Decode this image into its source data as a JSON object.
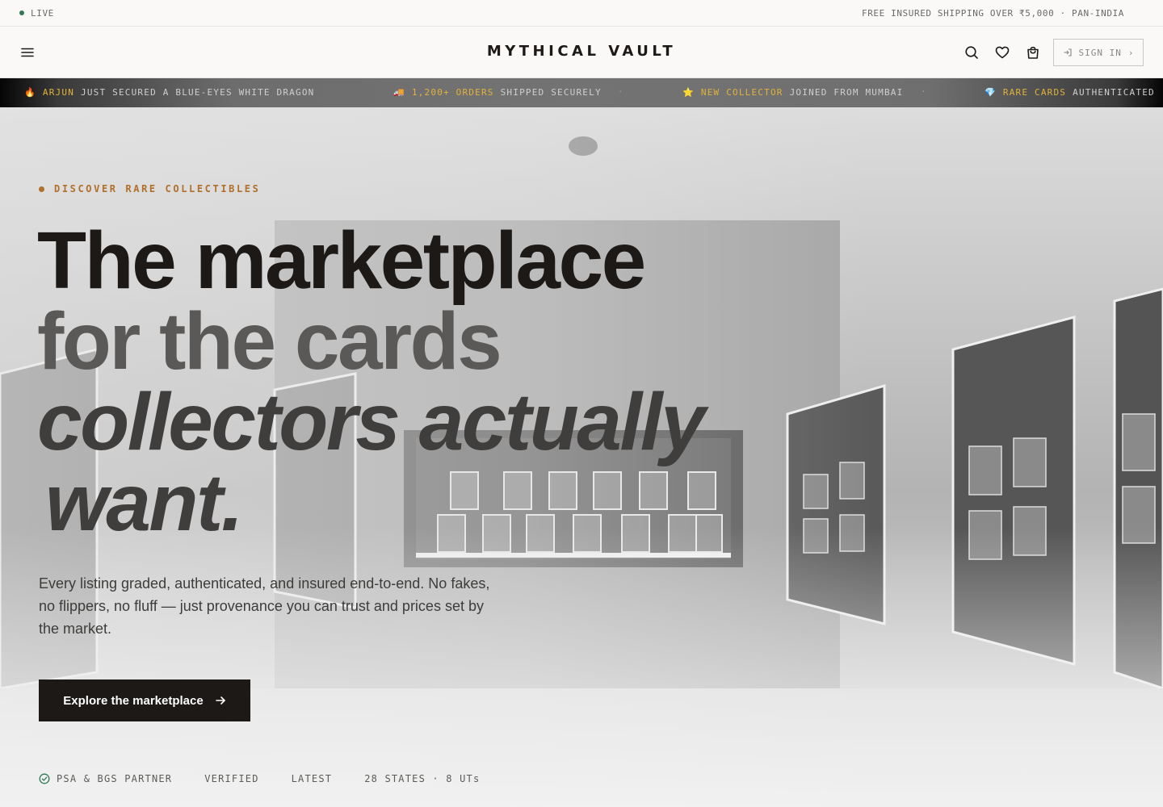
{
  "topbar": {
    "live_label": "LIVE",
    "shipping_note": "FREE INSURED SHIPPING OVER ₹5,000 · PAN-INDIA"
  },
  "header": {
    "brand": "MYTHICAL VAULT",
    "signin_label": "SIGN IN",
    "icons": [
      "menu-icon",
      "search-icon",
      "heart-icon",
      "shopping-bag-icon"
    ]
  },
  "ticker": {
    "items": [
      {
        "emoji": "🔥",
        "highlight": "ARJUN",
        "text": "JUST SECURED A BLUE-EYES WHITE DRAGON"
      },
      {
        "emoji": "🚚",
        "highlight": "1,200+ ORDERS",
        "text": "SHIPPED SECURELY"
      },
      {
        "emoji": "⭐",
        "highlight": "NEW COLLECTOR",
        "text": "JOINED FROM MUMBAI"
      },
      {
        "emoji": "💎",
        "highlight": "RARE CARDS",
        "text": "AUTHENTICATED"
      }
    ],
    "separator": "·"
  },
  "hero": {
    "eyebrow": "DISCOVER RARE COLLECTIBLES",
    "headline": {
      "line1": "The marketplace",
      "line2": "for the cards",
      "line3": "collectors actually",
      "line4": "want."
    },
    "subtext": "Every listing graded, authenticated, and insured end-to-end. No fakes, no flippers, no fluff — just provenance you can trust and prices set by the market.",
    "cta_label": "Explore the marketplace",
    "badges": [
      "PSA & BGS PARTNER",
      "VERIFIED",
      "LATEST",
      "28 STATES · 8 UTs"
    ]
  },
  "colors": {
    "accent": "#b06f2a",
    "ticker_highlight": "#e2b23c",
    "live_green": "#2f7a55",
    "cta_bg": "#1c1917"
  }
}
